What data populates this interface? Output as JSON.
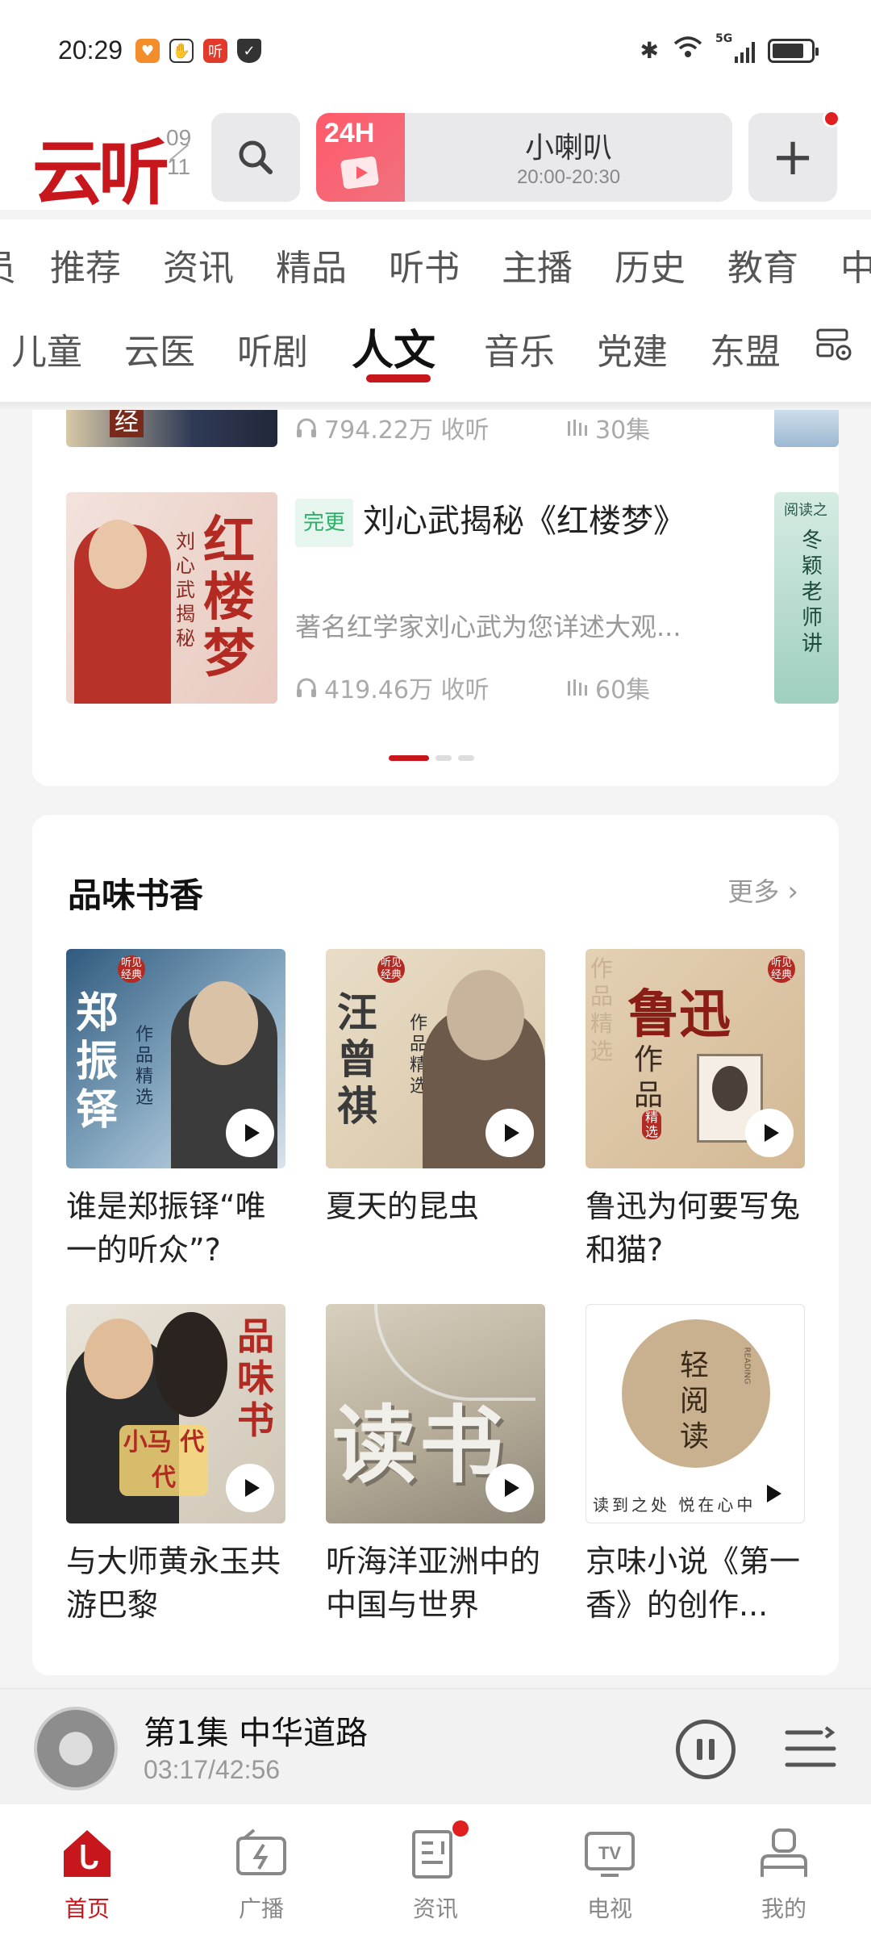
{
  "status_bar": {
    "time": "20:29",
    "app_badge_text": "听",
    "network": "5G"
  },
  "header": {
    "logo_text": "云听",
    "date_month": "09",
    "date_day": "11",
    "live": {
      "badge": "24H",
      "title": "小喇叭",
      "time": "20:00-20:30"
    },
    "add_label": "+"
  },
  "categories_row1": [
    "员",
    "推荐",
    "资讯",
    "精品",
    "听书",
    "主播",
    "历史",
    "教育",
    "中"
  ],
  "categories_row2": [
    "儿童",
    "云医",
    "听剧",
    "人文",
    "音乐",
    "党建",
    "东盟"
  ],
  "active_category": "人文",
  "top_card": {
    "prev_item": {
      "listens": "794.22万 收听",
      "episodes": "30集",
      "thumb_text": "经"
    },
    "current_item": {
      "badge": "完更",
      "title": "刘心武揭秘《红楼梦》",
      "description": "著名红学家刘心武为您详述大观...",
      "listens": "419.46万 收听",
      "episodes": "60集",
      "thumb_text_big": "红楼梦",
      "thumb_text_small": "刘心武揭秘"
    },
    "peek_text": "冬颖老师讲",
    "peek_top": "阅读之"
  },
  "section": {
    "title": "品味书香",
    "more": "更多",
    "items": [
      {
        "caption": "谁是郑振铎“唯一的听众”?",
        "thumb_big": "郑振铎",
        "thumb_small": "作品精选",
        "badge": "听见经典"
      },
      {
        "caption": "夏天的昆虫",
        "thumb_big": "汪曾祺",
        "thumb_small": "作品精选",
        "badge": "听见经典"
      },
      {
        "caption": "鲁迅为何要写兔和猫?",
        "thumb_big": "鲁迅",
        "thumb_small": "作品",
        "thumb_sub": "精选",
        "badge": "听见经典",
        "thumb_bg_text": "作品精选"
      },
      {
        "caption": "与大师黄永玉共游巴黎",
        "thumb_big": "品味书",
        "thumb_small": "小马 代代"
      },
      {
        "caption": "听海洋亚洲中的中国与世界",
        "thumb_big": "读书"
      },
      {
        "caption": "京味小说《第一香》的创作...",
        "thumb_big": "轻阅读",
        "thumb_small": "读到之处 悦在心中",
        "thumb_tiny": "READING"
      }
    ]
  },
  "player": {
    "title": "第1集 中华道路",
    "time": "03:17/42:56"
  },
  "bottom_nav": [
    {
      "label": "首页",
      "icon": "home-icon"
    },
    {
      "label": "广播",
      "icon": "radio-icon"
    },
    {
      "label": "资讯",
      "icon": "news-icon"
    },
    {
      "label": "电视",
      "icon": "tv-icon"
    },
    {
      "label": "我的",
      "icon": "profile-icon"
    }
  ],
  "colors": {
    "brand": "#c8161d",
    "done_badge": "#2fae6a",
    "background": "#f4f4f5"
  }
}
